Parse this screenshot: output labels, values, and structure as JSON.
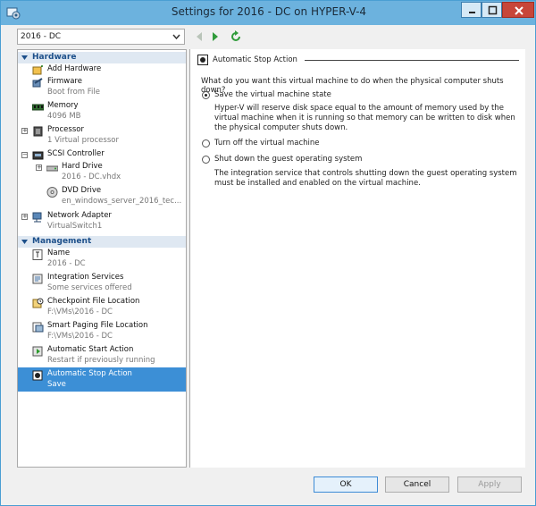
{
  "window": {
    "title": "Settings for 2016 - DC on HYPER-V-4"
  },
  "vm_selector": {
    "value": "2016 - DC"
  },
  "tree": {
    "hardware_header": "Hardware",
    "management_header": "Management",
    "hardware": [
      {
        "label": "Add Hardware",
        "sub": "",
        "icon": "add-hardware-icon"
      },
      {
        "label": "Firmware",
        "sub": "Boot from File",
        "icon": "firmware-icon"
      },
      {
        "label": "Memory",
        "sub": "4096 MB",
        "icon": "memory-icon"
      },
      {
        "label": "Processor",
        "sub": "1 Virtual processor",
        "icon": "processor-icon"
      },
      {
        "label": "SCSI Controller",
        "sub": "",
        "icon": "scsi-controller-icon"
      },
      {
        "label": "Hard Drive",
        "sub": "2016 - DC.vhdx",
        "icon": "hard-drive-icon"
      },
      {
        "label": "DVD Drive",
        "sub": "en_windows_server_2016_tec...",
        "icon": "dvd-drive-icon"
      },
      {
        "label": "Network Adapter",
        "sub": "VirtualSwitch1",
        "icon": "network-adapter-icon"
      }
    ],
    "management": [
      {
        "label": "Name",
        "sub": "2016 - DC",
        "icon": "name-icon"
      },
      {
        "label": "Integration Services",
        "sub": "Some services offered",
        "icon": "integration-services-icon"
      },
      {
        "label": "Checkpoint File Location",
        "sub": "F:\\VMs\\2016 - DC",
        "icon": "checkpoint-icon"
      },
      {
        "label": "Smart Paging File Location",
        "sub": "F:\\VMs\\2016 - DC",
        "icon": "smart-paging-icon"
      },
      {
        "label": "Automatic Start Action",
        "sub": "Restart if previously running",
        "icon": "start-action-icon"
      },
      {
        "label": "Automatic Stop Action",
        "sub": "Save",
        "icon": "stop-action-icon"
      }
    ]
  },
  "pane": {
    "header": "Automatic Stop Action",
    "question": "What do you want this virtual machine to do when the physical computer shuts down?",
    "options": [
      {
        "label": "Save the virtual machine state",
        "selected": true
      },
      {
        "label": "Turn off the virtual machine",
        "selected": false
      },
      {
        "label": "Shut down the guest operating system",
        "selected": false
      }
    ],
    "save_desc": "Hyper-V will reserve disk space equal to the amount of memory used by the virtual machine when it is running so that memory can be written to disk when the physical computer shuts down.",
    "shutdown_desc": "The integration service that controls shutting down the guest operating system must be installed and enabled on the virtual machine."
  },
  "buttons": {
    "ok": "OK",
    "cancel": "Cancel",
    "apply": "Apply"
  },
  "colors": {
    "titlebar": "#6cb2de",
    "selection": "#3c8fd6",
    "section_header": "#1c4f8a"
  }
}
